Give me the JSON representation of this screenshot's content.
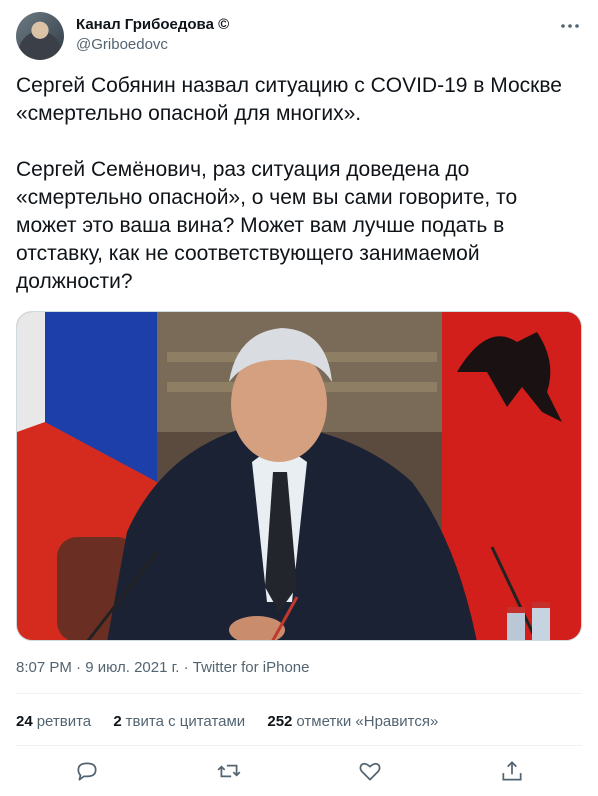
{
  "author": {
    "display_name": "Канал Грибоедова ©",
    "handle": "@Griboedovc"
  },
  "tweet": {
    "text": "Сергей Собянин назвал ситуацию с COVID-19 в Москве «смертельно опасной для многих».\n\nСергей Семёнович, раз ситуация доведена до «смертельно опасной», о чем вы сами говорите, то может это ваша вина? Может вам лучше подать в отставку, как не соответствующего занимаемой должности?",
    "meta": "8:07 PM · 9 июл. 2021 г. · Twitter for iPhone"
  },
  "stats": {
    "retweets_count": "24",
    "retweets_label": "ретвита",
    "quotes_count": "2",
    "quotes_label": "твита с цитатами",
    "likes_count": "252",
    "likes_label": "отметки «Нравится»"
  },
  "icons": {
    "more": "more-dots-icon",
    "reply": "reply-icon",
    "retweet": "retweet-icon",
    "like": "heart-icon",
    "share": "share-icon"
  },
  "colors": {
    "text": "#0f1419",
    "secondary": "#536471",
    "divider": "#eff3f4",
    "flag_red": "#d52b1e",
    "flag_blue": "#1c3faa"
  }
}
